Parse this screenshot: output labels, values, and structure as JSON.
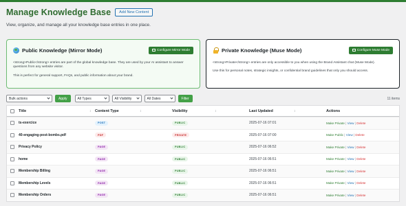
{
  "header": {
    "title": "Manage Knowledge Base",
    "add_button": "Add New Content",
    "subtitle": "View, organize, and manage all your knowledge base entries in one place."
  },
  "cards": {
    "public": {
      "title": "Public Knowledge (Mirror Mode)",
      "button": "Configure Mirror Mode",
      "text1": "<strong>Public</strong> entries are part of the global knowledge base. They are used by your AI assistant to answer questions from any website visitor.",
      "text2": "This is perfect for general support, FAQs, and public information about your brand.",
      "icon": "globe-icon"
    },
    "private": {
      "title": "Private Knowledge (Muse Mode)",
      "button": "Configure Muse Mode",
      "text1": "<strong>Private</strong> entries are only accessible to you when using the Brand Assistant chat (Muse Mode).",
      "text2": "Use this for personal notes, strategic insights, or confidential brand guidelines that only you should access.",
      "icon": "lock-icon"
    }
  },
  "filters": {
    "bulk_actions": "Bulk actions",
    "apply": "Apply",
    "types": "All Types",
    "visibility": "All Visibility",
    "dates": "All Dates",
    "filter": "Filter",
    "items_count": "11 items"
  },
  "table": {
    "columns": [
      "Title",
      "Content Type",
      "Visibility",
      "Last Updated",
      "Actions"
    ],
    "rows": [
      {
        "title": "ts-exercice",
        "type": "POST",
        "visibility": "PUBLIC",
        "updated": "2025-07-16 07:01",
        "make": "Make Private",
        "view": "View",
        "delete": "Delete"
      },
      {
        "title": "40-engaging-post-bombs.pdf",
        "type": "PDF",
        "visibility": "PRIVATE",
        "updated": "2025-07-16 07:00",
        "make": "Make Public",
        "view": "View",
        "delete": "Delete"
      },
      {
        "title": "Privacy Policy",
        "type": "PAGE",
        "visibility": "PUBLIC",
        "updated": "2025-07-16 06:52",
        "make": "Make Private",
        "view": "View",
        "delete": "Delete"
      },
      {
        "title": "home",
        "type": "PAGE",
        "visibility": "PUBLIC",
        "updated": "2025-07-16 06:51",
        "make": "Make Private",
        "view": "View",
        "delete": "Delete"
      },
      {
        "title": "Membership Billing",
        "type": "PAGE",
        "visibility": "PUBLIC",
        "updated": "2025-07-16 06:51",
        "make": "Make Private",
        "view": "View",
        "delete": "Delete"
      },
      {
        "title": "Membership Levels",
        "type": "PAGE",
        "visibility": "PUBLIC",
        "updated": "2025-07-16 06:51",
        "make": "Make Private",
        "view": "View",
        "delete": "Delete"
      },
      {
        "title": "Membership Orders",
        "type": "PAGE",
        "visibility": "PUBLIC",
        "updated": "2025-07-16 06:51",
        "make": "Make Private",
        "view": "View",
        "delete": "Delete"
      }
    ]
  },
  "colors": {
    "brand": "#2e7d32",
    "link": "#2271b1",
    "danger": "#d63638"
  }
}
